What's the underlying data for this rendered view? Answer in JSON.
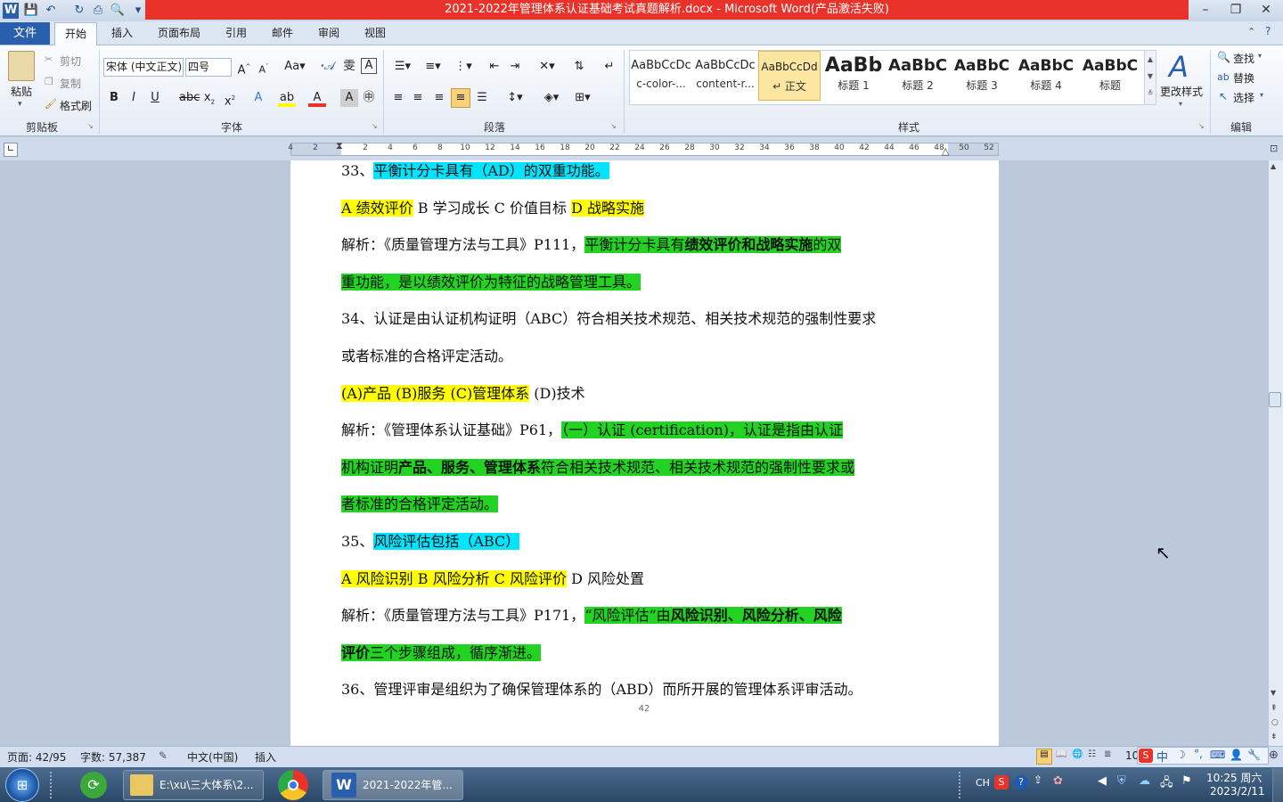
{
  "window": {
    "title": "2021-2022年管理体系认证基础考试真题解析.docx  -  Microsoft Word(产品激活失败)",
    "min": "–",
    "max": "❐",
    "close": "✕"
  },
  "tabs": {
    "file": "文件",
    "home": "开始",
    "insert": "插入",
    "layout": "页面布局",
    "references": "引用",
    "mailings": "邮件",
    "review": "审阅",
    "view": "视图"
  },
  "ribbon": {
    "clipboard": {
      "paste": "粘贴",
      "cut": "剪切",
      "copy": "复制",
      "format_painter": "格式刷",
      "label": "剪贴板"
    },
    "font": {
      "name": "宋体 (中文正文)",
      "size": "四号",
      "label": "字体"
    },
    "paragraph": {
      "label": "段落"
    },
    "styles": {
      "label": "样式",
      "items": [
        {
          "sample": "AaBbCcDc",
          "name": "c-color-..."
        },
        {
          "sample": "AaBbCcDc",
          "name": "content-r..."
        },
        {
          "sample": "AaBbCcDd",
          "name": "↵ 正文"
        },
        {
          "sample": "AaBb",
          "name": "标题 1"
        },
        {
          "sample": "AaBbC",
          "name": "标题 2"
        },
        {
          "sample": "AaBbC",
          "name": "标题 3"
        },
        {
          "sample": "AaBbC",
          "name": "标题 4"
        },
        {
          "sample": "AaBbC",
          "name": "标题"
        }
      ],
      "change": "更改样式"
    },
    "editing": {
      "find": "查找",
      "replace": "替换",
      "select": "选择",
      "label": "编辑"
    }
  },
  "ruler": {
    "ticks": [
      "4",
      "2",
      "",
      "2",
      "4",
      "6",
      "8",
      "10",
      "12",
      "14",
      "16",
      "18",
      "20",
      "22",
      "24",
      "26",
      "28",
      "30",
      "32",
      "34",
      "36",
      "38",
      "40",
      "42",
      "44",
      "46",
      "48",
      "50",
      "52"
    ]
  },
  "doc": {
    "q33": {
      "num": "33、",
      "text": "平衡计分卡具有（AD）的双重功能。"
    },
    "q33_opts": {
      "a": "A 绩效评价",
      "bc": "  B 学习成长  C 价值目标  ",
      "d": "D 战略实施"
    },
    "q33_ans1": {
      "pre": "解析：《质量管理方法与工具》P111，",
      "g1": "平衡计分卡具有",
      "bold": "绩效评价和战略实施",
      "g2": "的双"
    },
    "q33_ans2": "重功能，是以绩效评价为特征的战略管理工具。",
    "q34_1": "34、认证是由认证机构证明（ABC）符合相关技术规范、相关技术规范的强制性要求",
    "q34_2": "或者标准的合格评定活动。",
    "q34_opts": {
      "abc": "(A)产品  (B)服务  (C)管理体系",
      "d": "  (D)技术"
    },
    "q34_ans1": {
      "pre": "解析：《管理体系认证基础》P61，",
      "g": "（一）认证 (certification)，认证是指由认证"
    },
    "q34_ans2": {
      "g1": "机构证明",
      "bold": "产品、服务、管理体系",
      "g2": "符合相关技术规范、相关技术规范的强制性要求或"
    },
    "q34_ans3": "者标准的合格评定活动。",
    "q35": {
      "num": "35、",
      "text": "风险评估包括（ABC）"
    },
    "q35_opts": {
      "abc": "A 风险识别  B 风险分析  C 风险评价",
      "d": "  D 风险处置"
    },
    "q35_ans1": {
      "pre": "解析：《质量管理方法与工具》P171，",
      "g1": "“风险评估”由",
      "bold": "风险识别、风险分析、风险"
    },
    "q35_ans2": {
      "bold": "评价",
      "g": "三个步骤组成，循序渐进。"
    },
    "q36": "36、管理评审是组织为了确保管理体系的（ABD）而所开展的管理体系评审活动。",
    "page_number": "42"
  },
  "status": {
    "page": "页面: 42/95",
    "words": "字数: 57,387",
    "lang": "中文(中国)",
    "mode": "插入",
    "zoom": "10"
  },
  "taskbar": {
    "explorer": "E:\\xu\\三大体系\\2...",
    "word": "2021-2022年管...",
    "ime": "CH",
    "time": "10:25 周六",
    "date": "2023/2/11"
  },
  "colors": {
    "title_red": "#e8322a",
    "file_tab": "#2a5fae",
    "hl_yellow": "#ffff00",
    "hl_cyan": "#00e5ff",
    "hl_green": "#22d322"
  }
}
